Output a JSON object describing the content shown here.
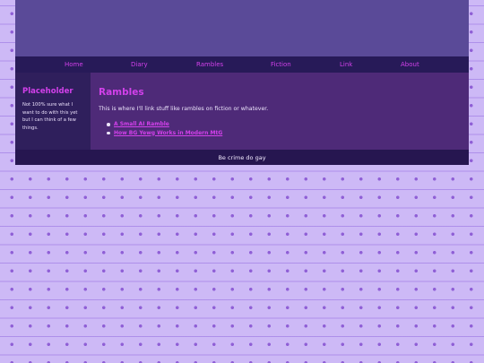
{
  "nav": {
    "items": [
      {
        "label": "Home"
      },
      {
        "label": "Diary"
      },
      {
        "label": "Rambles"
      },
      {
        "label": "Fiction"
      },
      {
        "label": "Link"
      },
      {
        "label": "About"
      }
    ]
  },
  "sidebar": {
    "title": "Placeholder",
    "text": "Not 100% sure what I want to do with this yet but I can think of a few things."
  },
  "main": {
    "title": "Rambles",
    "intro": "This is where I'll link stuff like rambles on fiction or whatever.",
    "links": [
      {
        "label": "A Small AI Ramble"
      },
      {
        "label": "How BG Yewg Works in Modern MtG"
      }
    ]
  },
  "footer": {
    "text": "Be crime do gay"
  },
  "colors": {
    "accent": "#d240ea",
    "banner": "#5a4a98",
    "nav": "#271a58",
    "page_bg": "#cdb9f6"
  }
}
